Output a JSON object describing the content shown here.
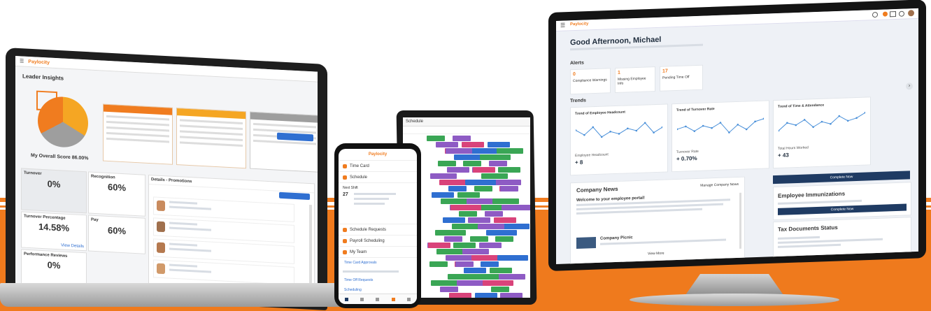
{
  "colors": {
    "brand": "#f07c1f",
    "navy": "#1f3b63",
    "amber": "#f5a623",
    "grey": "#9e9e9e"
  },
  "laptop": {
    "brand": "Paylocity",
    "page_title": "Leader Insights",
    "overall_score": "My Overall Score 86.00%",
    "kpis": [
      {
        "label": "Turnover",
        "value": "0%"
      },
      {
        "label": "Recognition",
        "value": "60%"
      },
      {
        "label": "Turnover Percentage",
        "value": "14.58%"
      },
      {
        "label": "Pay",
        "value": "60%"
      },
      {
        "label": "Performance Reviews",
        "value": "0%"
      }
    ],
    "panel_title": "Details - Promotions",
    "view_more": "View Details"
  },
  "phone": {
    "brand": "Paylocity",
    "items": [
      {
        "label": "Time Card",
        "icon": "clock-icon"
      },
      {
        "label": "Schedule",
        "icon": "calendar-icon"
      },
      {
        "label": "Schedule Requests",
        "icon": "calendar-icon"
      },
      {
        "label": "Payroll Scheduling",
        "icon": "money-icon"
      },
      {
        "label": "My Team",
        "icon": "team-icon"
      }
    ],
    "team_links": [
      "Time Card Approvals",
      "Time Off Requests",
      "Scheduling"
    ],
    "shift_text": "Next Shift",
    "shift_date": "27"
  },
  "tablet": {
    "header": "Schedule"
  },
  "monitor": {
    "brand": "Paylocity",
    "greeting": "Good Afternoon, Michael",
    "alerts_title": "Alerts",
    "alerts": [
      {
        "count": "0",
        "label": "Compliance Warnings"
      },
      {
        "count": "1",
        "label": "Missing Employee Info"
      },
      {
        "count": "17",
        "label": "Pending Time Off"
      }
    ],
    "trends_title": "Trends",
    "trends": [
      {
        "title": "Trend of Employee Headcount",
        "metric_label": "Employee Headcount",
        "metric_value": "+ 8",
        "points": [
          6,
          4,
          7,
          3,
          5,
          4,
          6,
          5,
          8,
          4,
          6
        ]
      },
      {
        "title": "Trend of Turnover Rate",
        "metric_label": "Turnover Rate",
        "metric_value": "+ 0.70%",
        "points": [
          5,
          6,
          4,
          6,
          5,
          7,
          3,
          6,
          4,
          7,
          8
        ]
      },
      {
        "title": "Trend of Time & Attendance",
        "metric_label": "Total Hours Worked",
        "metric_value": "+ 43",
        "points": [
          3,
          6,
          5,
          7,
          4,
          6,
          5,
          8,
          6,
          7,
          9
        ]
      }
    ],
    "news_title": "Company News",
    "news_button": "Manage Company News",
    "news_post_title": "Welcome to your employee portal!",
    "news_post2_title": "Company Picnic",
    "view_more": "View More",
    "action_button": "Complete Now",
    "immunizations_title": "Employee Immunizations",
    "immunizations_button": "Complete Now",
    "tax_title": "Tax Documents Status"
  }
}
